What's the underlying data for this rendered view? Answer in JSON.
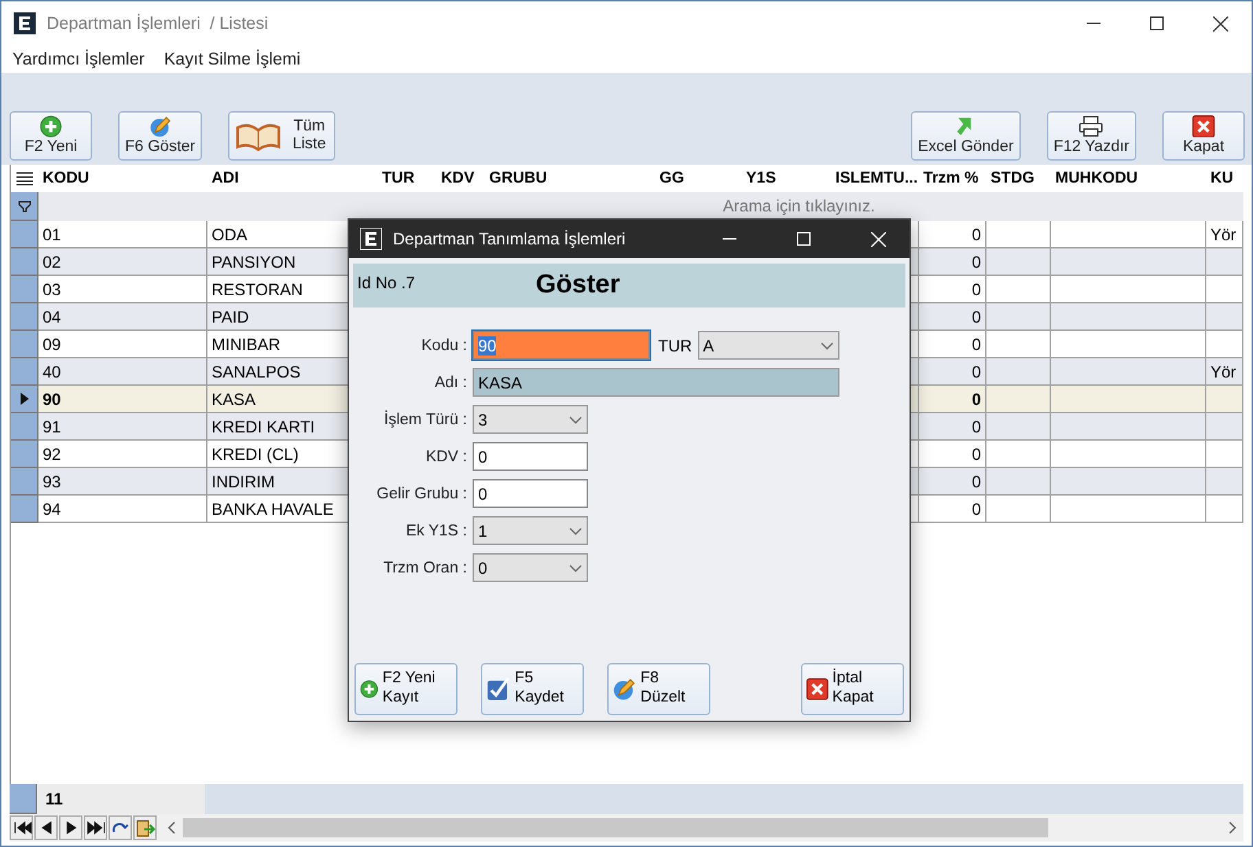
{
  "window": {
    "title": "Departman İşlemleri  / Listesi"
  },
  "menu": [
    "Yardımcı İşlemler",
    "Kayıt Silme İşlemi"
  ],
  "toolbar_left": [
    {
      "label": "F2 Yeni",
      "kind": "add"
    },
    {
      "label": "F6 Göster",
      "kind": "edit"
    },
    {
      "label": "Tüm Liste",
      "kind": "book"
    }
  ],
  "toolbar_right": [
    {
      "label": "Excel Gönder",
      "kind": "excel"
    },
    {
      "label": "F12 Yazdır",
      "kind": "print"
    },
    {
      "label": "Kapat",
      "kind": "close"
    }
  ],
  "grid": {
    "columns": [
      "KODU",
      "ADI",
      "TUR",
      "KDV",
      "GRUBU",
      "GG",
      "Y1S",
      "ISLEMTU...",
      "Trzm %",
      "STDG",
      "MUHKODU",
      "KU"
    ],
    "filter_hint": "Arama için tıklayınız.",
    "rows": [
      {
        "kodu": "01",
        "adi": "ODA",
        "trzm": "0",
        "ku": "Yör",
        "selected": false
      },
      {
        "kodu": "02",
        "adi": "PANSIYON",
        "trzm": "0",
        "ku": "",
        "selected": false
      },
      {
        "kodu": "03",
        "adi": "RESTORAN",
        "trzm": "0",
        "ku": "",
        "selected": false
      },
      {
        "kodu": "04",
        "adi": "PAID",
        "trzm": "0",
        "ku": "",
        "selected": false
      },
      {
        "kodu": "09",
        "adi": "MINIBAR",
        "trzm": "0",
        "ku": "",
        "selected": false
      },
      {
        "kodu": "40",
        "adi": "SANALPOS",
        "trzm": "0",
        "ku": "Yör",
        "selected": false
      },
      {
        "kodu": "90",
        "adi": "KASA",
        "trzm": "0",
        "ku": "",
        "selected": true
      },
      {
        "kodu": "91",
        "adi": "KREDI KARTI",
        "trzm": "0",
        "ku": "",
        "selected": false
      },
      {
        "kodu": "92",
        "adi": "KREDI (CL)",
        "trzm": "0",
        "ku": "",
        "selected": false
      },
      {
        "kodu": "93",
        "adi": "INDIRIM",
        "trzm": "0",
        "ku": "",
        "selected": false
      },
      {
        "kodu": "94",
        "adi": "BANKA HAVALE",
        "trzm": "0",
        "ku": "",
        "selected": false
      }
    ],
    "record_count": "11"
  },
  "dialog": {
    "title": "Departman Tanımlama İşlemleri",
    "id_label": "Id No .7",
    "heading": "Göster",
    "kodu": {
      "label": "Kodu :",
      "value": "90",
      "focused": true
    },
    "tur": {
      "label": "TUR",
      "value": "A"
    },
    "fields": [
      {
        "label": "Adı :",
        "value": "KASA",
        "kind": "display",
        "focused": false
      },
      {
        "label": "İşlem Türü :",
        "value": "3",
        "kind": "select",
        "focused": false
      },
      {
        "label": "KDV :",
        "value": "0",
        "kind": "input",
        "focused": false
      },
      {
        "label": "Gelir Grubu :",
        "value": "0",
        "kind": "input",
        "focused": false
      },
      {
        "label": "Ek Y1S  :",
        "value": "1",
        "kind": "select",
        "focused": false
      },
      {
        "label": "Trzm Oran  :",
        "value": "0",
        "kind": "select",
        "focused": false
      }
    ],
    "buttons": [
      {
        "label": "F2 Yeni Kayıt",
        "kind": "add"
      },
      {
        "label": "F5 Kaydet",
        "kind": "save"
      },
      {
        "label": "F8 Düzelt",
        "kind": "edit"
      },
      {
        "label": "İptal Kapat",
        "kind": "close"
      }
    ]
  }
}
